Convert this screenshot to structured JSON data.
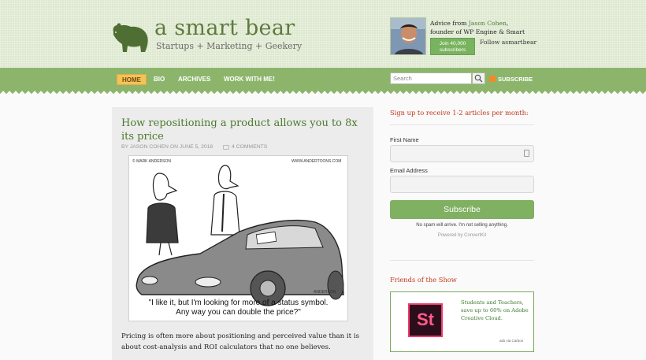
{
  "header": {
    "site_title": "a smart bear",
    "tagline": "Startups + Marketing + Geekery",
    "author_prefix": "Advice from ",
    "author_name": "Jason Cohen",
    "author_role": ", founder of ",
    "company_1": "WP Engine",
    "and_text": " & ",
    "company_2": "Smart Bear Software",
    "period": ".",
    "join_label": "Join 40,000 subscribers",
    "follow_label": "Follow asmartbear"
  },
  "nav": {
    "items": [
      {
        "label": "HOME",
        "active": true
      },
      {
        "label": "BIO"
      },
      {
        "label": "ARCHIVES"
      },
      {
        "label": "WORK WITH ME!"
      }
    ],
    "search_placeholder": "Search",
    "subscribe_label": "SUBSCRIBE"
  },
  "article": {
    "title": "How repositioning a product allows you to 8x its price",
    "meta": "BY JASON COHEN ON JUNE 5, 2018",
    "comments": "4 COMMENTS",
    "cartoon": {
      "credit_left": "© MARK ANDERSON",
      "credit_right": "WWW.ANDERTOONS.COM",
      "signature": "ANDERSON",
      "caption_line1": "\"I like it, but I'm looking for more of a status symbol.",
      "caption_line2": "Any way you can double the price?\""
    },
    "body": "Pricing is often more about positioning and perceived value than it is about cost-analysis and ROI calculators that no one believes."
  },
  "sidebar": {
    "signup_heading": "Sign up to receive 1-2 articles per month:",
    "first_name_label": "First Name",
    "email_label": "Email Address",
    "subscribe_button": "Subscribe",
    "no_spam": "No spam will arrive. I'm not selling anything.",
    "powered_by": "Powered by ConvertKit",
    "friends_heading": "Friends of the Show",
    "ad": {
      "logo_text": "St",
      "text": "Students and Teachers, save up to 60% on Adobe Creative Cloud.",
      "via": "ads via Carbon"
    }
  },
  "colors": {
    "nav_green": "#8cb56b",
    "title_green": "#4b7a2c",
    "heading_red": "#c0391a",
    "active_tab": "#f5c25a"
  }
}
